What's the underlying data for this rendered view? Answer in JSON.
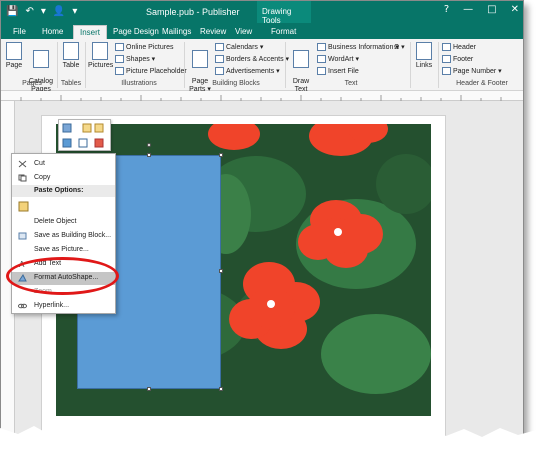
{
  "titlebar": {
    "title": "Sample.pub - Publisher",
    "context_tab": "Drawing Tools",
    "help": "?",
    "minimize": "—",
    "maximize": "□",
    "close": "✕",
    "qa": [
      "💾",
      "↶",
      "▾",
      "👤",
      "▾"
    ]
  },
  "tabs": [
    "File",
    "Home",
    "Insert",
    "Page Design",
    "Mailings",
    "Review",
    "View",
    "Format"
  ],
  "ribbon": {
    "pages": {
      "label": "Pages",
      "page": "Page",
      "catalog": "Catalog\nPages"
    },
    "tables": {
      "label": "Tables",
      "table": "Table"
    },
    "illustrations": {
      "label": "Illustrations",
      "pictures": "Pictures",
      "online": "Online Pictures",
      "shapes": "Shapes ▾",
      "placeholder": "Picture Placeholder"
    },
    "building": {
      "label": "Building Blocks",
      "parts": "Page\nParts ▾",
      "calendars": "Calendars ▾",
      "borders": "Borders & Accents ▾",
      "ads": "Advertisements ▾"
    },
    "text": {
      "label": "Text",
      "draw": "Draw\nText Box",
      "bizinfo": "Business Information ▾",
      "wordart": "WordArt ▾",
      "insertfile": "Insert File",
      "omega": "Ω ▾"
    },
    "links": {
      "label": "",
      "links": "Links"
    },
    "hf": {
      "label": "Header & Footer",
      "header": "Header",
      "footer": "Footer",
      "pagenum": "Page Number ▾"
    }
  },
  "context_menu": {
    "cut": "Cut",
    "copy": "Copy",
    "paste_options": "Paste Options:",
    "delete": "Delete Object",
    "save_bb": "Save as Building Block...",
    "save_pic": "Save as Picture...",
    "add_text": "Add Text",
    "format": "Format AutoShape...",
    "zoom": "Zoom",
    "hyperlink": "Hyperlink..."
  },
  "colors": {
    "accent": "#077568",
    "shape_fill": "#5b9bd5",
    "highlight_ring": "#e01818"
  }
}
